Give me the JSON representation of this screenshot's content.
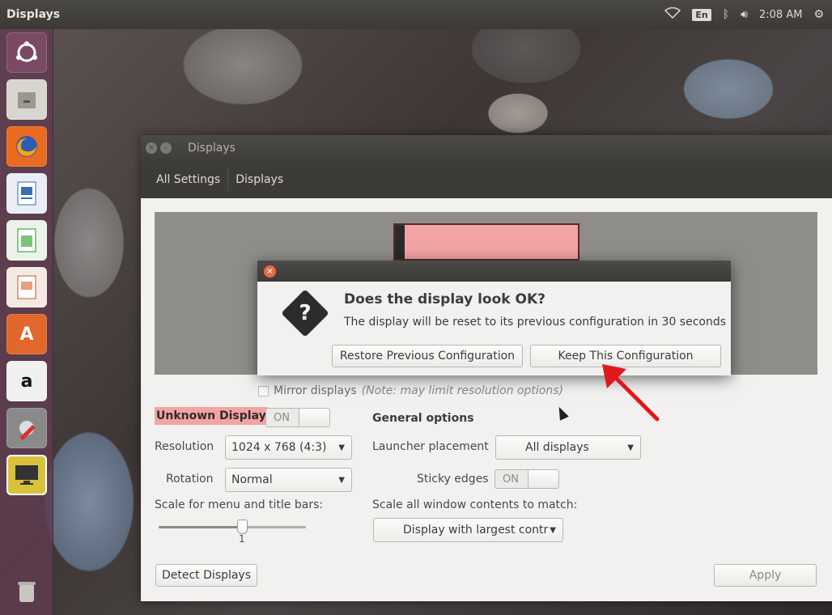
{
  "top_panel": {
    "title": "Displays",
    "lang": "En",
    "time": "2:08 AM"
  },
  "launcher": {
    "items": [
      "ubuntu-icon",
      "files-icon",
      "firefox-icon",
      "writer-icon",
      "calc-icon",
      "impress-icon",
      "software-center-icon",
      "amazon-icon",
      "system-settings-icon",
      "displays-icon",
      "trash-icon"
    ]
  },
  "window": {
    "title": "Displays",
    "toolbar": {
      "all_settings": "All Settings",
      "displays": "Displays"
    },
    "mirror": {
      "label": "Mirror displays",
      "note": "(Note: may limit resolution options)"
    },
    "display_name": "Unknown Display",
    "display_toggle": "ON",
    "resolution_label": "Resolution",
    "resolution_value": "1024 x 768 (4:3)",
    "rotation_label": "Rotation",
    "rotation_value": "Normal",
    "scale_label": "Scale for menu and title bars:",
    "scale_value": "1",
    "general_heading": "General options",
    "launcher_placement_label": "Launcher placement",
    "launcher_placement_value": "All displays",
    "sticky_edges_label": "Sticky edges",
    "sticky_edges_toggle": "ON",
    "scale_all_label": "Scale all window contents to match:",
    "scale_all_value": "Display with largest contr",
    "detect_button": "Detect Displays",
    "apply_button": "Apply"
  },
  "dialog": {
    "heading": "Does the display look OK?",
    "message": "The display will be reset to its previous configuration in 30 seconds",
    "restore_button": "Restore Previous Configuration",
    "keep_button": "Keep This Configuration"
  },
  "colors": {
    "display_highlight": "#f3a3a3",
    "annotation_arrow": "#e0191b",
    "close_button": "#e96a4a"
  }
}
